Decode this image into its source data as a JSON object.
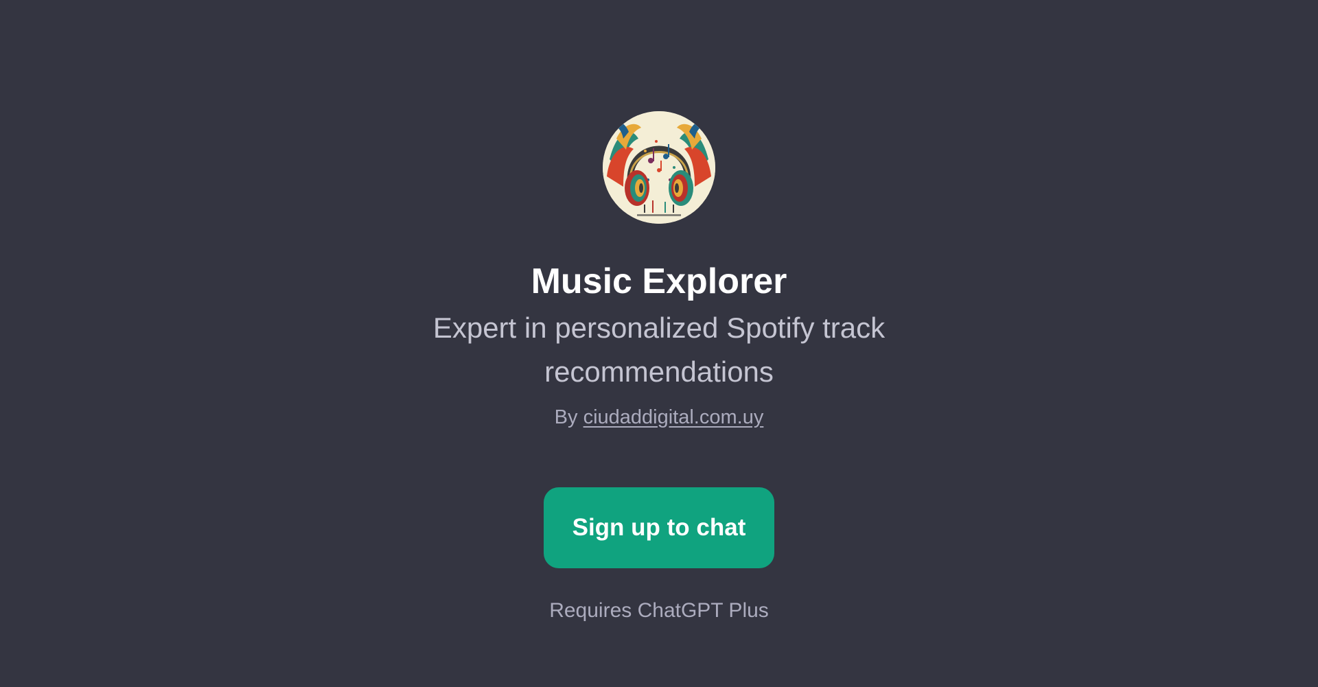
{
  "gpt": {
    "name": "Music Explorer",
    "description": "Expert in personalized Spotify track recommendations",
    "by_prefix": "By ",
    "author": "ciudaddigital.com.uy",
    "avatar_icon": "headphones-music-icon"
  },
  "cta": {
    "label": "Sign up to chat"
  },
  "footer": {
    "requirement": "Requires ChatGPT Plus"
  },
  "colors": {
    "background": "#343541",
    "accent": "#10a37f",
    "title": "#ffffff",
    "muted": "#acacbe"
  }
}
